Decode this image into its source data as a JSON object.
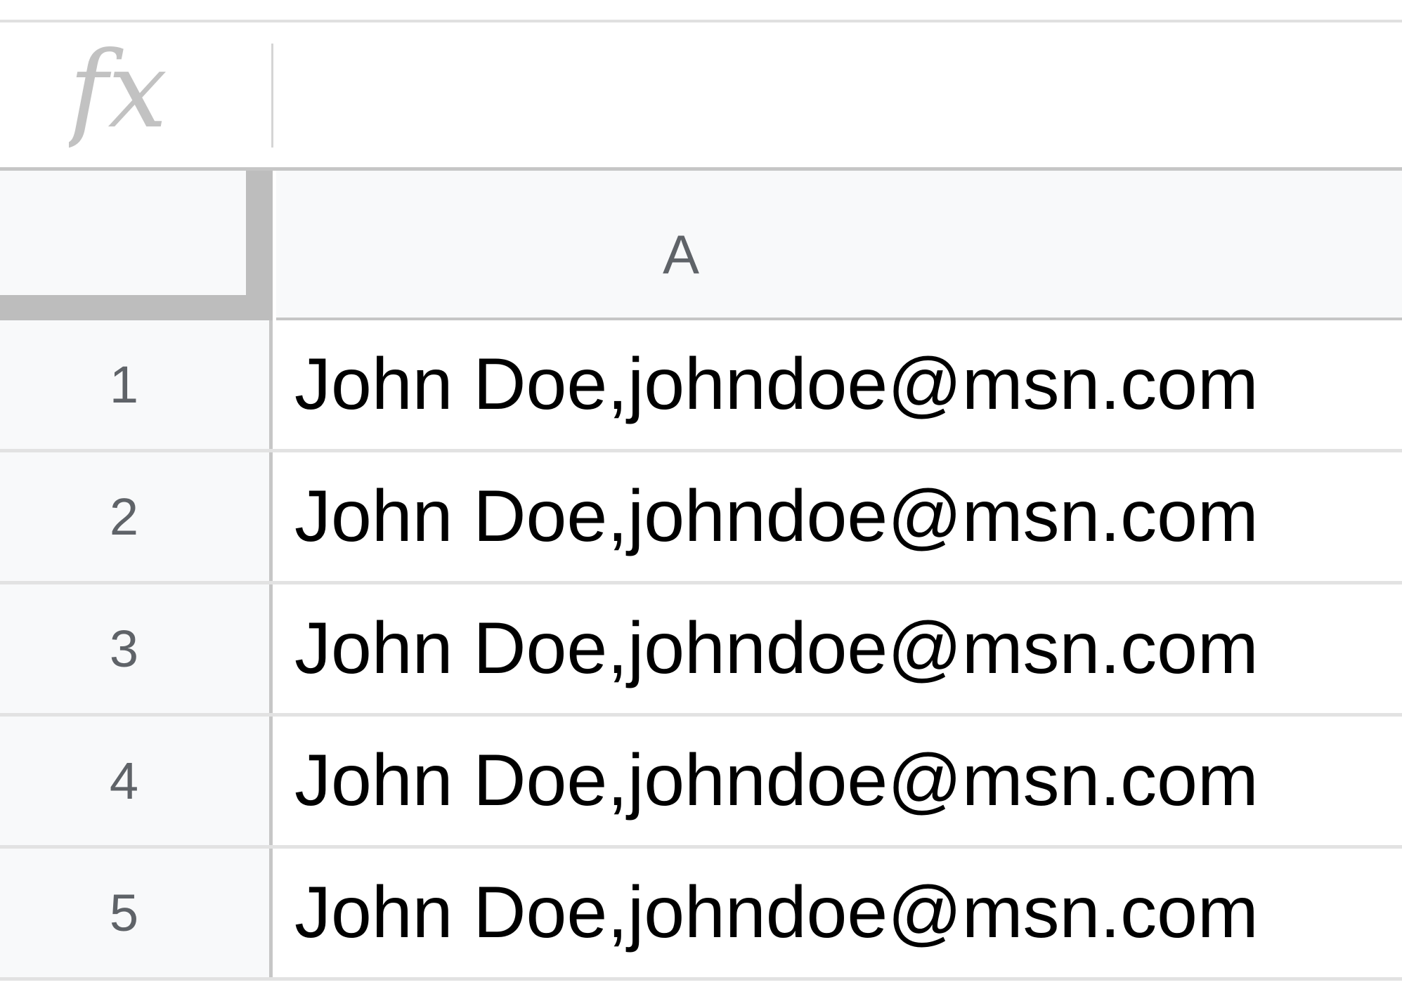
{
  "formula_bar": {
    "icon": "fx-icon",
    "value": ""
  },
  "column_headers": [
    "A"
  ],
  "rows": [
    {
      "row_label": "1",
      "cell_a": "John Doe,johndoe@msn.com"
    },
    {
      "row_label": "2",
      "cell_a": "John Doe,johndoe@msn.com"
    },
    {
      "row_label": "3",
      "cell_a": "John Doe,johndoe@msn.com"
    },
    {
      "row_label": "4",
      "cell_a": "John Doe,johndoe@msn.com"
    },
    {
      "row_label": "5",
      "cell_a": "John Doe,johndoe@msn.com"
    }
  ],
  "colors": {
    "header_bg": "#f8f9fa",
    "header_text": "#5f6368",
    "gridline": "#e2e2e2",
    "frozen_bar": "#bdbdbd"
  }
}
